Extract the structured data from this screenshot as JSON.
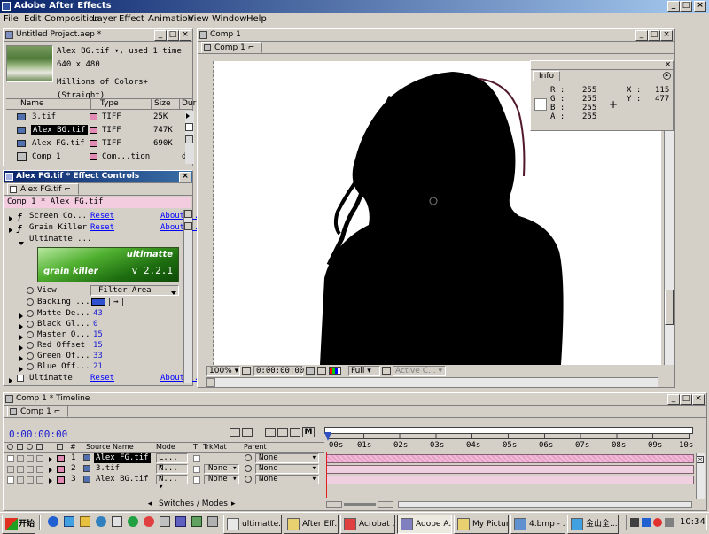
{
  "app": {
    "title": "Adobe After Effects"
  },
  "menu": [
    "File",
    "Edit",
    "Composition",
    "Layer",
    "Effect",
    "Animation",
    "View",
    "Window",
    "Help"
  ],
  "project": {
    "title": "Untitled Project.aep *",
    "info": {
      "name": "Alex BG.tif ▾, used 1 time",
      "dims": "640 x 480",
      "colors": "Millions of Colors+ (Straight)"
    },
    "columns": [
      "Name",
      "Type",
      "Size",
      "Dur"
    ],
    "items": [
      {
        "name": "3.tif",
        "type": "TIFF",
        "size": "25K",
        "swatch": "#e08ab4"
      },
      {
        "name": "Alex BG.tif",
        "type": "TIFF",
        "size": "747K",
        "swatch": "#e08ab4",
        "selected": true
      },
      {
        "name": "Alex FG.tif",
        "type": "TIFF",
        "size": "690K",
        "swatch": "#e08ab4"
      },
      {
        "name": "Comp 1",
        "type": "Com...tion",
        "size": "",
        "dur": "d",
        "swatch": "#e08ab4"
      }
    ]
  },
  "effects": {
    "title": "Alex FG.tif * Effect Controls",
    "tab": "Alex FG.tif",
    "path": "Comp 1 * Alex FG.tif",
    "items": [
      {
        "name": "Screen Co...",
        "reset": "Reset",
        "about": "About..."
      },
      {
        "name": "Grain Killer",
        "reset": "Reset",
        "about": "About..."
      },
      {
        "name": "Ultimatte ...",
        "reset": "",
        "about": ""
      }
    ],
    "logo": {
      "brand": "ultimatte",
      "product": "grain killer",
      "version": "v 2.2.1"
    },
    "params": [
      {
        "name": "View",
        "value": "Filter Area"
      },
      {
        "name": "Backing ...",
        "value": ""
      },
      {
        "name": "Matte De...",
        "value": "43"
      },
      {
        "name": "Black Gl...",
        "value": "0"
      },
      {
        "name": "Master O...",
        "value": "15"
      },
      {
        "name": "Red Offset",
        "value": "15"
      },
      {
        "name": "Green Of...",
        "value": "33"
      },
      {
        "name": "Blue Off...",
        "value": "21"
      }
    ],
    "last": {
      "name": "Ultimatte",
      "reset": "Reset",
      "about": "About..."
    }
  },
  "comp": {
    "title": "Comp 1",
    "tab": "Comp 1",
    "zoom": "100%",
    "timecode": "0:00:00:00",
    "quality": "Full",
    "view": "Active C..."
  },
  "info_panel": {
    "title": "Info",
    "r": "255",
    "g": "255",
    "b": "255",
    "a": "255",
    "x": "115",
    "y": "477",
    "labels": {
      "r": "R :",
      "g": "G :",
      "b": "B :",
      "a": "A :",
      "x": "X :",
      "y": "Y :"
    }
  },
  "timeline": {
    "title": "Comp 1 * Timeline",
    "tab": "Comp 1",
    "timecode": "0:00:00:00",
    "headers": {
      "num": "#",
      "source": "Source Name",
      "mode": "Mode",
      "t": "T",
      "trkmat": "TrkMat",
      "parent": "Parent"
    },
    "ticks": [
      "00s",
      "01s",
      "02s",
      "03s",
      "04s",
      "05s",
      "06s",
      "07s",
      "08s",
      "09s",
      "10s"
    ],
    "layers": [
      {
        "num": "1",
        "name": "Alex FG.tif",
        "mode": "L...",
        "trkmat": "",
        "parent": "None",
        "selected": true
      },
      {
        "num": "2",
        "name": "3.tif",
        "mode": "N...",
        "trkmat": "None",
        "parent": "None"
      },
      {
        "num": "3",
        "name": "Alex BG.tif",
        "mode": "N...",
        "trkmat": "None",
        "parent": "None"
      }
    ],
    "switches": "Switches / Modes"
  },
  "taskbar": {
    "start": "开始",
    "tasks": [
      "ultimatte...",
      "After Eff...",
      "Acrobat ...",
      "Adobe A...",
      "My Pictures",
      "4.bmp - ...",
      "金山全..."
    ],
    "clock": "10:34"
  }
}
